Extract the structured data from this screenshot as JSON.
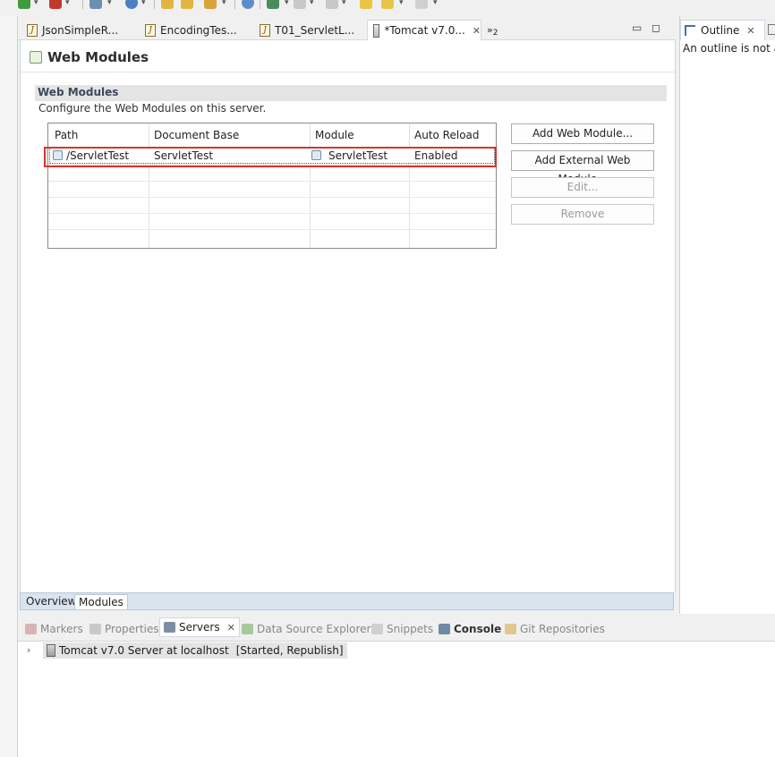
{
  "editor_tabs": [
    {
      "label": "JsonSimpleR..."
    },
    {
      "label": "EncodingTes..."
    },
    {
      "label": "T01_ServletL..."
    },
    {
      "label": "*Tomcat v7.0..."
    }
  ],
  "tab_overflow": {
    "label": "»",
    "count": "2"
  },
  "editor": {
    "page_title": "Web Modules",
    "section_title": "Web Modules",
    "section_description": "Configure the Web Modules on this server.",
    "table": {
      "headers": [
        "Path",
        "Document Base",
        "Module",
        "Auto Reload"
      ],
      "rows": [
        {
          "path": "/ServletTest",
          "document_base": "ServletTest",
          "module": "ServletTest",
          "auto_reload": "Enabled"
        }
      ]
    },
    "buttons": {
      "add_web_module": "Add Web Module...",
      "add_external_web_module": "Add External Web Module...",
      "edit": "Edit...",
      "remove": "Remove"
    },
    "page_tabs": [
      "Overview",
      "Modules"
    ]
  },
  "outline": {
    "tab_label": "Outline",
    "message": "An outline is not av"
  },
  "bottom_views": [
    "Markers",
    "Properties",
    "Servers",
    "Data Source Explorer",
    "Snippets",
    "Console",
    "Git Repositories"
  ],
  "servers": [
    {
      "name": "Tomcat v7.0 Server at localhost",
      "status": "[Started, Republish]"
    }
  ],
  "colors": {
    "accent": "#d9332f",
    "tab_border": "#cfd8e3",
    "page_tab_bg": "#d9e4ee"
  },
  "icons": [
    "run-icon",
    "debug-icon",
    "new-server-icon",
    "globe-icon",
    "open-folder-icon",
    "forward-icon",
    "back-icon",
    "java-file-icon",
    "server-icon",
    "outline-icon",
    "markers-icon",
    "properties-icon",
    "servers-icon",
    "datasource-icon",
    "snippets-icon",
    "console-icon",
    "git-icon"
  ]
}
